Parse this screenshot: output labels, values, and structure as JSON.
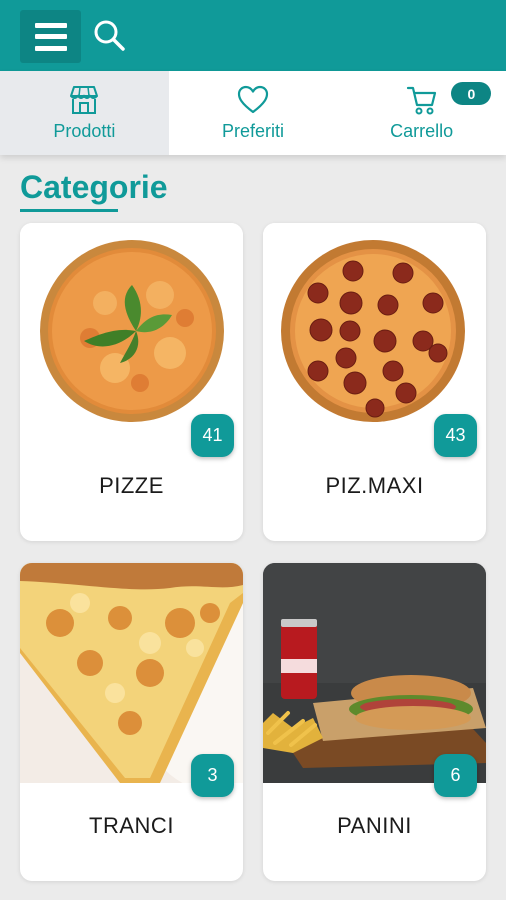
{
  "header": {
    "menu_icon": "hamburger-menu-icon",
    "search_icon": "search-icon",
    "brand_color": "#109a99"
  },
  "tabs": [
    {
      "label": "Prodotti",
      "icon": "store-icon",
      "active": true
    },
    {
      "label": "Preferiti",
      "icon": "heart-icon",
      "active": false
    },
    {
      "label": "Carrello",
      "icon": "cart-icon",
      "active": false,
      "badge": "0"
    }
  ],
  "main": {
    "section_title": "Categorie",
    "categories": [
      {
        "name": "PIZZE",
        "count": "41",
        "image": "margherita-pizza-photo"
      },
      {
        "name": "PIZ.MAXI",
        "count": "43",
        "image": "pepperoni-pizza-photo"
      },
      {
        "name": "TRANCI",
        "count": "3",
        "image": "pizza-slice-photo"
      },
      {
        "name": "PANINI",
        "count": "6",
        "image": "kebab-sandwich-photo"
      }
    ]
  }
}
